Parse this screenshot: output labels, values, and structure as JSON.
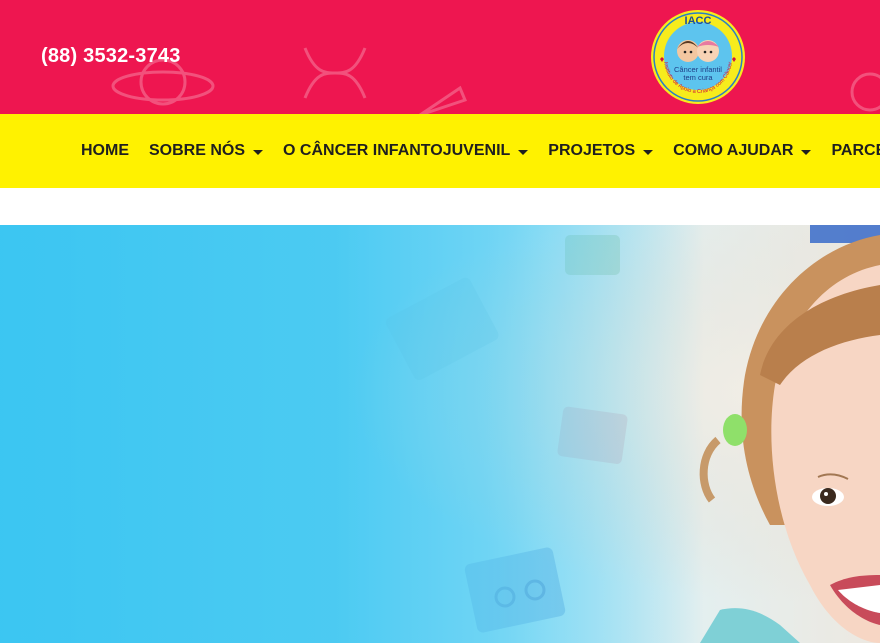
{
  "header": {
    "phone": "(88) 3532-3743",
    "logo": {
      "title": "IACC",
      "tagline_line1": "Câncer infantil",
      "tagline_line2": "tem cura",
      "arc_text": "Instituto de Apoio a Criança com Câncer"
    }
  },
  "nav": {
    "items": [
      {
        "label": "HOME",
        "has_dropdown": false
      },
      {
        "label": "SOBRE NÓS",
        "has_dropdown": true
      },
      {
        "label": "O CÂNCER INFANTOJUVENIL",
        "has_dropdown": true
      },
      {
        "label": "PROJETOS",
        "has_dropdown": true
      },
      {
        "label": "COMO AJUDAR",
        "has_dropdown": true
      },
      {
        "label": "PARCEIROS",
        "has_dropdown": false
      }
    ]
  },
  "colors": {
    "topbar": "#ee1650",
    "navbar": "#fff200",
    "hero": "#0ab8ef"
  },
  "hero": {
    "image": "smiling-child-on-carpet-photo"
  }
}
